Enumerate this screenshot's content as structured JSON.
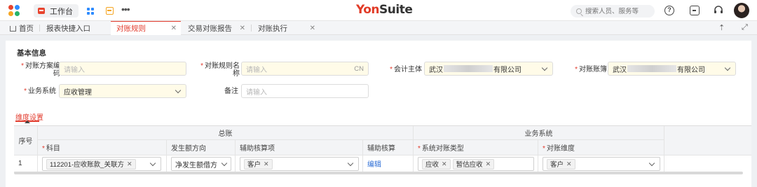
{
  "topbar": {
    "workbench_label": "工作台",
    "brand_prefix": "Yon",
    "brand_suffix": "Suite",
    "search_placeholder": "搜索人员、服务等",
    "help_symbol": "?"
  },
  "tabs": [
    {
      "label": "首页",
      "closable": false
    },
    {
      "label": "报表快捷入口",
      "closable": false
    },
    {
      "label": "对账规则",
      "closable": true,
      "active": true
    },
    {
      "label": "交易对账报告",
      "closable": true
    },
    {
      "label": "对账执行",
      "closable": true
    }
  ],
  "colors": {
    "accent": "#e23b2d",
    "brand": "#e13b27",
    "link": "#2f6fd6",
    "required_bg": "#fffbe8"
  },
  "form": {
    "section_title": "基本信息",
    "scheme_code_label": "对账方案编码",
    "scheme_code_placeholder": "请输入",
    "rule_name_label": "对账规则名称",
    "rule_name_placeholder": "请输入",
    "rule_name_suffix": "CN",
    "entity_label": "会计主体",
    "entity_value_start": "武汉",
    "entity_value_end": "有限公司",
    "book_label": "对账账簿",
    "book_value_start": "武汉",
    "book_value_end": "有限公司",
    "business_label": "业务系统",
    "business_value": "应收管理",
    "remark_label": "备注",
    "remark_placeholder": "请输入"
  },
  "dimension_tab": "维度设置",
  "table": {
    "group_general_ledger": "总账",
    "group_business": "业务系统",
    "col_seq": "序号",
    "col_subject": "科目",
    "col_direction": "发生额方向",
    "col_aux_item": "辅助核算项",
    "col_aux": "辅助核算",
    "col_sys_type": "系统对账类型",
    "col_dimension": "对账维度",
    "rows": [
      {
        "seq": "1",
        "subject_tag": "112201-应收账款_关联方",
        "direction": "净发生额借方",
        "aux_item_tag": "客户",
        "aux_link": "编辑",
        "sys_type_tags": [
          "应收",
          "暂估应收"
        ],
        "dimension_tag": "客户"
      }
    ]
  }
}
